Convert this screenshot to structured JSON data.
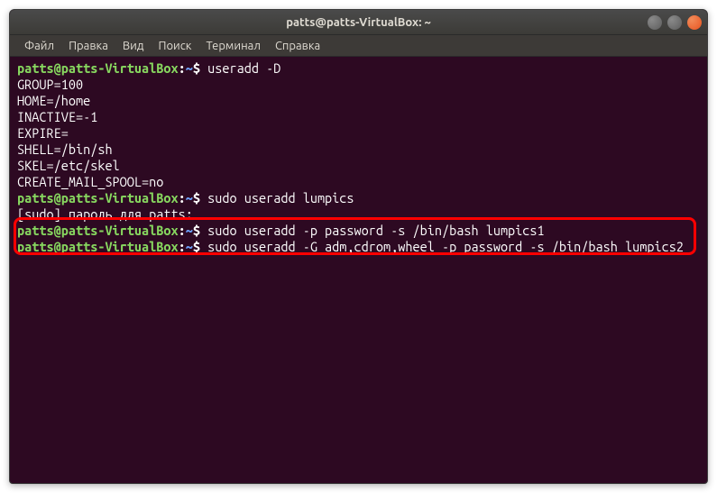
{
  "titlebar": {
    "title": "patts@patts-VirtualBox: ~"
  },
  "menu": {
    "file": "Файл",
    "edit": "Правка",
    "view": "Вид",
    "search": "Поиск",
    "terminal": "Терминал",
    "help": "Справка"
  },
  "lines": {
    "l1_user": "patts@patts-VirtualBox",
    "l1_colon": ":",
    "l1_path": "~",
    "l1_dollar": "$ ",
    "l1_cmd": "useradd -D",
    "l2": "GROUP=100",
    "l3": "HOME=/home",
    "l4": "INACTIVE=-1",
    "l5": "EXPIRE=",
    "l6": "SHELL=/bin/sh",
    "l7": "SKEL=/etc/skel",
    "l8": "CREATE_MAIL_SPOOL=no",
    "l9_user": "patts@patts-VirtualBox",
    "l9_colon": ":",
    "l9_path": "~",
    "l9_dollar": "$ ",
    "l9_cmd": "sudo useradd lumpics",
    "l10": "[sudo] пароль для patts:",
    "l11_user": "patts@patts-VirtualBox",
    "l11_colon": ":",
    "l11_path": "~",
    "l11_dollar": "$ ",
    "l11_cmd": "sudo useradd -p password -s /bin/bash lumpics1",
    "l12_user": "patts@patts-VirtualBox",
    "l12_colon": ":",
    "l12_path": "~",
    "l12_dollar": "$ ",
    "l12_cmd": "sudo useradd -G adm,cdrom,wheel -p password -s /bin/bash lumpics2"
  },
  "colors": {
    "highlight": "#ff0000"
  }
}
